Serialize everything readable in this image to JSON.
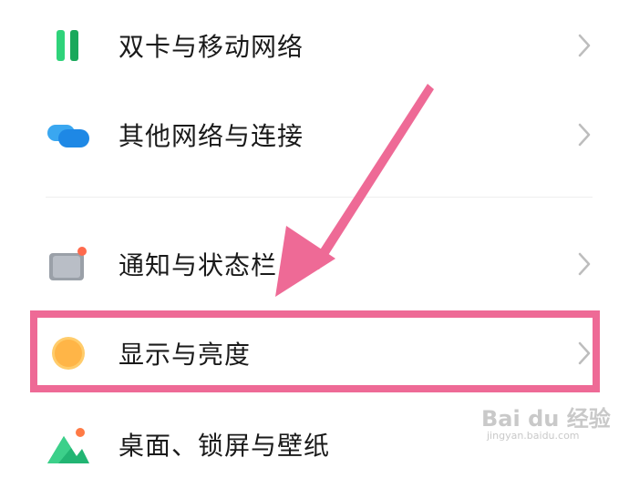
{
  "settings": {
    "items": [
      {
        "label": "双卡与移动网络",
        "icon": "dual-sim-icon"
      },
      {
        "label": "其他网络与连接",
        "icon": "connection-bubbles-icon"
      },
      {
        "label": "通知与状态栏",
        "icon": "notification-icon"
      },
      {
        "label": "显示与亮度",
        "icon": "brightness-icon"
      },
      {
        "label": "桌面、锁屏与壁纸",
        "icon": "wallpaper-icon"
      }
    ],
    "chevron_icon": "chevron-right-icon"
  },
  "annotation": {
    "arrow_color": "#ee6a96",
    "highlight_color": "#ee6a96"
  },
  "watermark": {
    "logo": "Bai du 经验",
    "url": "jingyan.baidu.com"
  }
}
